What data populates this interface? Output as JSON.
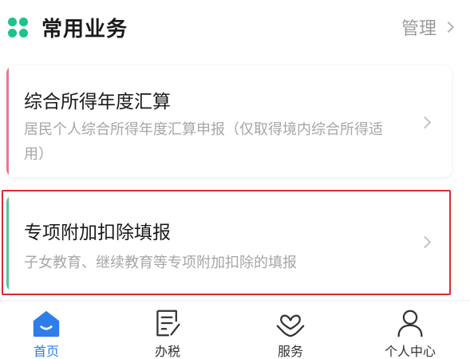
{
  "header": {
    "title": "常用业务",
    "manage_label": "管理"
  },
  "cards": [
    {
      "title": "综合所得年度汇算",
      "desc": "居民个人综合所得年度汇算申报（仅取得境内综合所得适用）"
    },
    {
      "title": "专项附加扣除填报",
      "desc": "子女教育、继续教育等专项附加扣除的填报"
    }
  ],
  "tabbar": {
    "home": "首页",
    "tax": "办税",
    "service": "服务",
    "me": "个人中心"
  },
  "colors": {
    "brand_green": "#1ec28b",
    "active_blue": "#2f7de8",
    "card1_accent": "#f0758f",
    "card2_accent": "#52c89a",
    "highlight_red": "#d92a35"
  }
}
